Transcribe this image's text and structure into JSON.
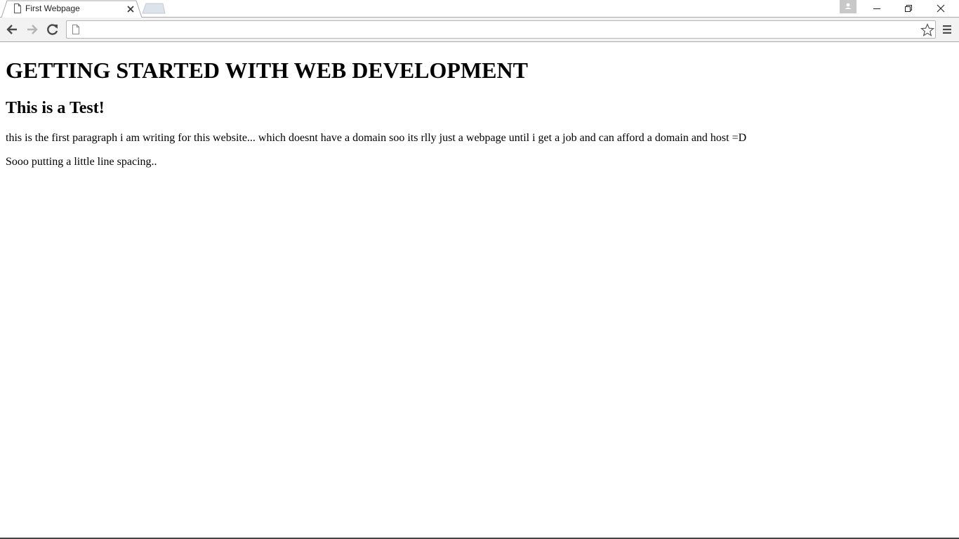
{
  "browser": {
    "tab": {
      "title": "First Webpage",
      "favicon": "page-icon",
      "close_icon": "close-icon"
    },
    "new_tab_icon": "new-tab-icon",
    "profile_icon": "person-icon",
    "window_controls": {
      "minimize_icon": "minimize-icon",
      "restore_icon": "restore-icon",
      "close_icon": "close-icon"
    },
    "toolbar": {
      "back_icon": "arrow-left-icon",
      "forward_icon": "arrow-right-icon",
      "reload_icon": "reload-icon",
      "address_value": "",
      "page_icon": "page-icon",
      "bookmark_icon": "star-icon",
      "menu_icon": "hamburger-menu-icon"
    }
  },
  "page": {
    "heading": "GETTING STARTED WITH WEB DEVELOPMENT",
    "subheading": "This is a Test!",
    "paragraphs": [
      "this is the first paragraph i am writing for this website... which doesnt have a domain soo its rlly just a webpage until i get a job and can afford a domain and host =D",
      "Sooo putting a little line spacing.."
    ]
  },
  "colors": {
    "toolbar_bg": "#f2f2f2",
    "tab_border": "#a8a8a8",
    "text": "#000000",
    "icon": "#4a4a4a",
    "icon_disabled": "#b4b4b4"
  }
}
